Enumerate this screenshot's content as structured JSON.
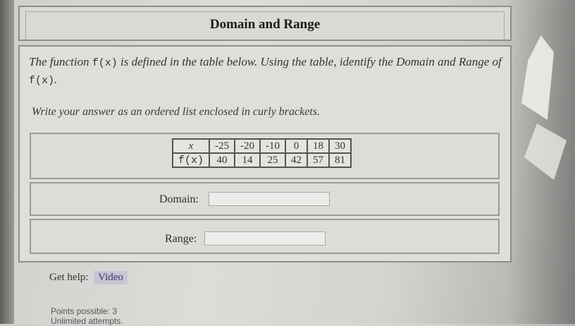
{
  "title": "Domain and Range",
  "question": {
    "intro_before_f1": "The function ",
    "f1": "f(x)",
    "intro_middle": " is defined in the table below. Using the table, identify the Domain and Range of ",
    "f2": "f(x)",
    "intro_end": ".",
    "instruction": "Write your answer as an ordered list enclosed in curly brackets."
  },
  "table": {
    "x_label": "x",
    "fx_label": "f(x)",
    "x_values": [
      "-25",
      "-20",
      "-10",
      "0",
      "18",
      "30"
    ],
    "fx_values": [
      "40",
      "14",
      "25",
      "42",
      "57",
      "81"
    ]
  },
  "answers": {
    "domain_label": "Domain:",
    "domain_value": "",
    "range_label": "Range:",
    "range_value": ""
  },
  "help": {
    "label": "Get help:",
    "video": "Video"
  },
  "footer": {
    "points": "Points possible: 3",
    "attempts": "Unlimited attempts."
  }
}
